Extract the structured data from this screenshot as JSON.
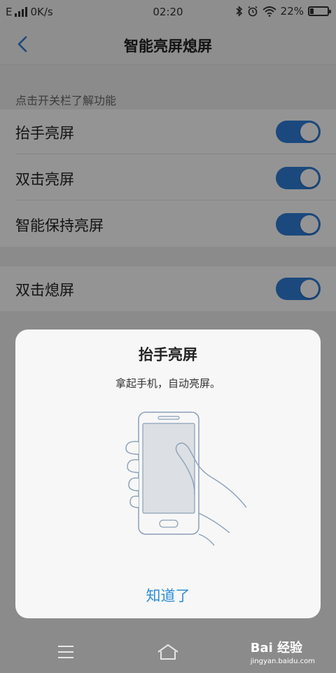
{
  "status_bar": {
    "network": "E",
    "speed": "0K/s",
    "time": "02:20",
    "battery_percent": "22%",
    "battery_level": 0.22
  },
  "header": {
    "title": "智能亮屏熄屏"
  },
  "settings": {
    "hint": "点击开关栏了解功能",
    "group1": [
      {
        "label": "抬手亮屏",
        "enabled": true
      },
      {
        "label": "双击亮屏",
        "enabled": true
      },
      {
        "label": "智能保持亮屏",
        "enabled": true
      }
    ],
    "group2": [
      {
        "label": "双击熄屏",
        "enabled": true
      }
    ]
  },
  "dialog": {
    "title": "抬手亮屏",
    "description": "拿起手机，自动亮屏。",
    "confirm_label": "知道了"
  },
  "watermark": {
    "brand": "Bai 经验",
    "url": "jingyan.baidu.com"
  },
  "colors": {
    "accent": "#2f7ed8",
    "link": "#2f8fd8"
  }
}
